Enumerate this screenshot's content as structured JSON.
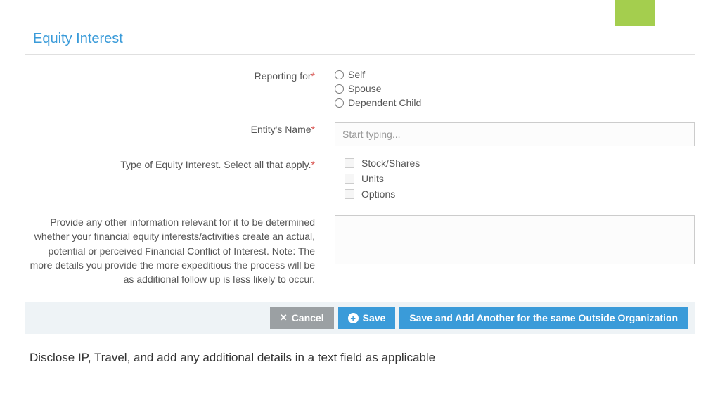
{
  "section_title": "Equity Interest",
  "form": {
    "reporting_for": {
      "label": "Reporting for",
      "options": [
        "Self",
        "Spouse",
        "Dependent Child"
      ]
    },
    "entity_name": {
      "label": "Entity's Name",
      "placeholder": "Start typing..."
    },
    "equity_type": {
      "label": "Type of Equity Interest. Select all that apply.",
      "options": [
        "Stock/Shares",
        "Units",
        "Options"
      ]
    },
    "other_info": {
      "label": "Provide any other information relevant for it to be determined whether your financial equity interests/activities create an actual, potential or perceived Financial Conflict of Interest. Note: The more details you provide the more expeditious the process will be as additional follow up is less likely to occur."
    }
  },
  "buttons": {
    "cancel": "Cancel",
    "save": "Save",
    "save_add": "Save and Add Another for the same Outside Organization"
  },
  "footer_note": "Disclose IP, Travel, and add any additional details in a text field as applicable"
}
